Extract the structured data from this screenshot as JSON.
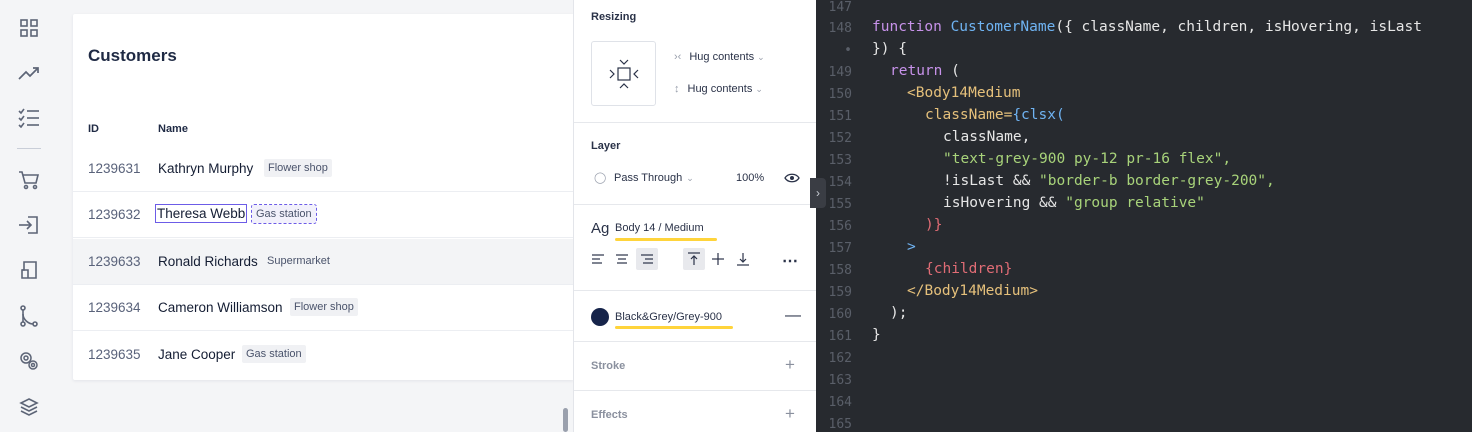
{
  "sidebar": {
    "icons": [
      "grid-icon",
      "trend-up-icon",
      "checklist-icon",
      "cart-icon",
      "login-icon",
      "document-icon",
      "git-branch-icon",
      "settings-gears-icon",
      "layers-icon"
    ]
  },
  "customers": {
    "title": "Customers",
    "columns": {
      "id": "ID",
      "name": "Name"
    },
    "rows": [
      {
        "id": "1239631",
        "name": "Kathryn Murphy",
        "tag": "Flower shop"
      },
      {
        "id": "1239632",
        "name": "Theresa Webb",
        "tag": "Gas station"
      },
      {
        "id": "1239633",
        "name": "Ronald Richards",
        "tag": "Supermarket"
      },
      {
        "id": "1239634",
        "name": "Cameron Williamson",
        "tag": "Flower shop"
      },
      {
        "id": "1239635",
        "name": "Jane Cooper",
        "tag": "Gas station"
      }
    ]
  },
  "inspector": {
    "resizing": {
      "title": "Resizing",
      "width_mode": "Hug contents",
      "height_mode": "Hug contents"
    },
    "layer": {
      "title": "Layer",
      "blend": "Pass Through",
      "opacity": "100%"
    },
    "text": {
      "prefix": "Ag",
      "style": "Body 14 / Medium"
    },
    "fill": {
      "color_name": "Black&Grey/Grey-900",
      "color": "#16244a"
    },
    "stroke": {
      "title": "Stroke"
    },
    "effects": {
      "title": "Effects"
    }
  },
  "editor": {
    "line_numbers": [
      "147",
      "148",
      "•",
      "149",
      "150",
      "151",
      "152",
      "153",
      "154",
      "155",
      "156",
      "157",
      "158",
      "159",
      "160",
      "161",
      "162",
      "163",
      "164",
      "165"
    ],
    "code": {
      "l148a": "function",
      "l148b": "CustomerName",
      "l148c": "({ className, children, isHovering, isLast",
      "l148d": "}) {",
      "l149a": "return",
      "l149b": " (",
      "l150": "<Body14Medium",
      "l151a": "className=",
      "l151b": "{clsx(",
      "l152": "className,",
      "l153": "\"text-grey-900 py-12 pr-16 flex\",",
      "l154a": "!isLast && ",
      "l154b": "\"border-b border-grey-200\",",
      "l155a": "isHovering && ",
      "l155b": "\"group relative\"",
      "l156": ")}",
      "l157": ">",
      "l158": "{children}",
      "l159": "</Body14Medium>",
      "l160": ");",
      "l161": "}"
    }
  }
}
